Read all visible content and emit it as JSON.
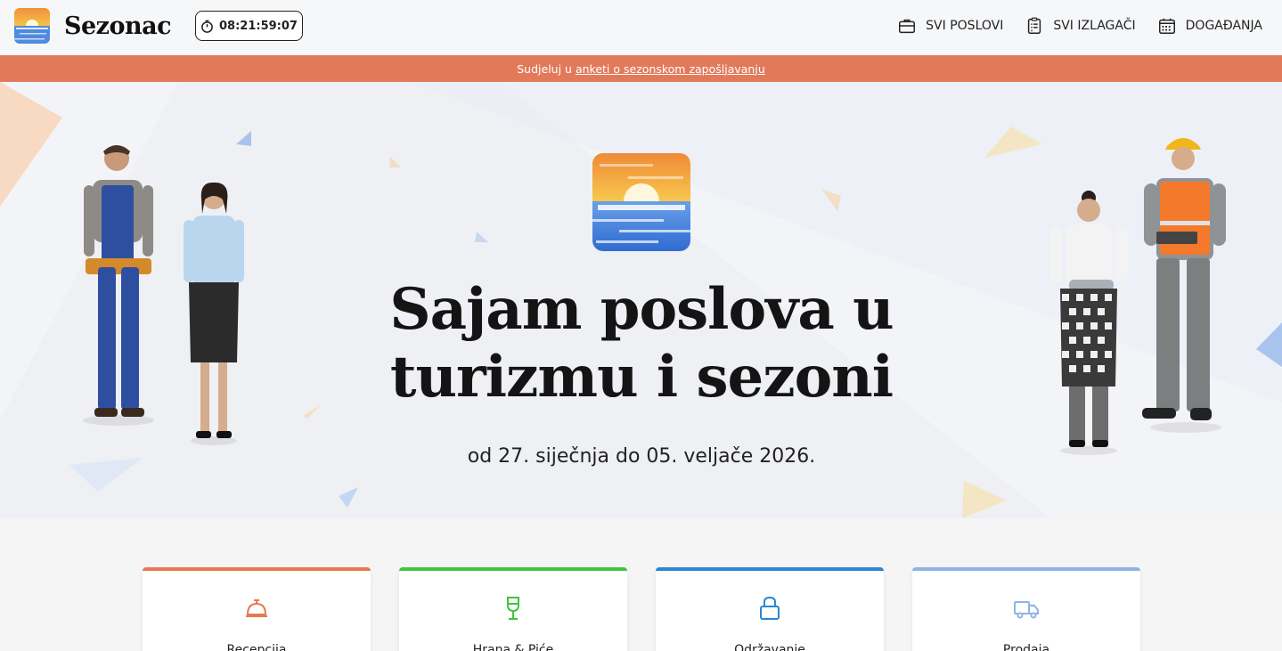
{
  "header": {
    "brand": "Sezonac",
    "timer": "08:21:59:07",
    "nav": [
      {
        "label": "SVI POSLOVI",
        "icon": "briefcase-icon"
      },
      {
        "label": "SVI IZLAGAČI",
        "icon": "clipboard-icon"
      },
      {
        "label": "DOGAĐANJA",
        "icon": "calendar-icon"
      }
    ]
  },
  "banner": {
    "prefix": "Sudjeluj u",
    "link": "anketi o sezonskom zapošljavanju"
  },
  "hero": {
    "title_line1": "Sajam poslova u",
    "title_line2": "turizmu i sezoni",
    "date": "od 27. siječnja do 05. veljače 2026."
  },
  "categories": [
    {
      "label": "Recepcija",
      "icon": "reception-bell-icon",
      "color": "#e8784f"
    },
    {
      "label": "Hrana & Piće",
      "icon": "wine-glass-icon",
      "color": "#3ec63e"
    },
    {
      "label": "Održavanje",
      "icon": "lock-icon",
      "color": "#2b86d6"
    },
    {
      "label": "Prodaja",
      "icon": "truck-icon",
      "color": "#8fb3e6"
    }
  ],
  "colors": {
    "banner": "#e27a5a",
    "accent_orange": "#e8784f"
  }
}
